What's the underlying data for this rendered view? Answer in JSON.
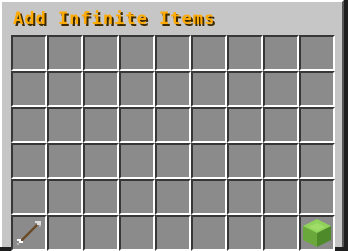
{
  "title": "Add Infinite Items",
  "grid": {
    "columns": 9,
    "rows": 6
  },
  "items": [
    {
      "row": 5,
      "col": 0,
      "icon": "arrow-item-icon"
    },
    {
      "row": 5,
      "col": 8,
      "icon": "slime-block-icon"
    }
  ],
  "colors": {
    "title": "#ffaa00",
    "panel": "#c6c6c6",
    "slot": "#8b8b8b",
    "slime": "#7ec04a"
  }
}
